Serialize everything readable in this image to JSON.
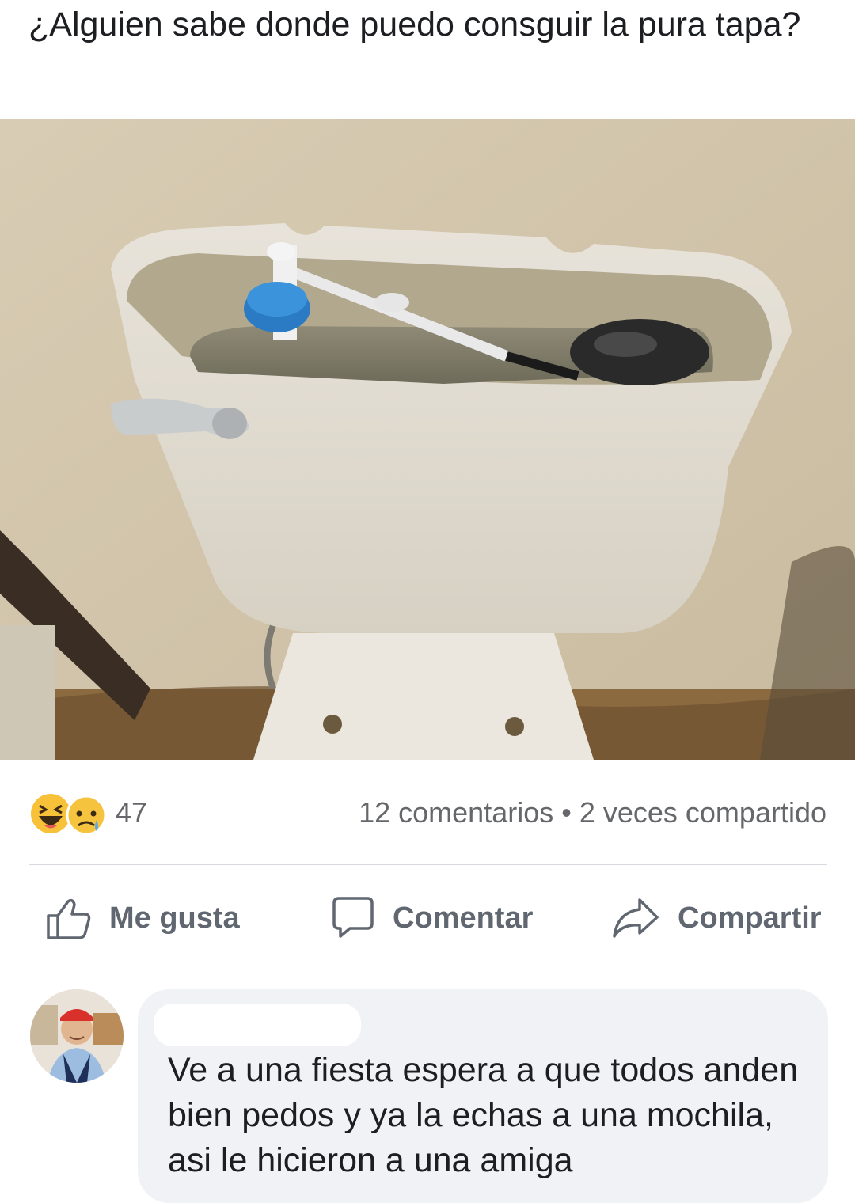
{
  "post": {
    "text": "¿Alguien sabe donde puedo consguir la pura tapa?",
    "photo_icon": "toilet-tank-photo"
  },
  "reactions": {
    "icons": [
      "haha-emoji-icon",
      "sad-emoji-icon"
    ],
    "count": "47"
  },
  "engagement": {
    "comments": "12 comentarios",
    "separator": "•",
    "shares": "2 veces compartido"
  },
  "actions": {
    "like_label": "Me gusta",
    "comment_label": "Comentar",
    "share_label": "Compartir"
  },
  "comment": {
    "text": "Ve a una fiesta espera a que todos anden bien pedos y ya la echas a una mochila, asi le hicieron a una amiga"
  },
  "colors": {
    "text": "#1c1e21",
    "muted": "#65676b",
    "action": "#606770",
    "divider": "#d8dadf",
    "comment_bg": "#f0f2f5"
  }
}
